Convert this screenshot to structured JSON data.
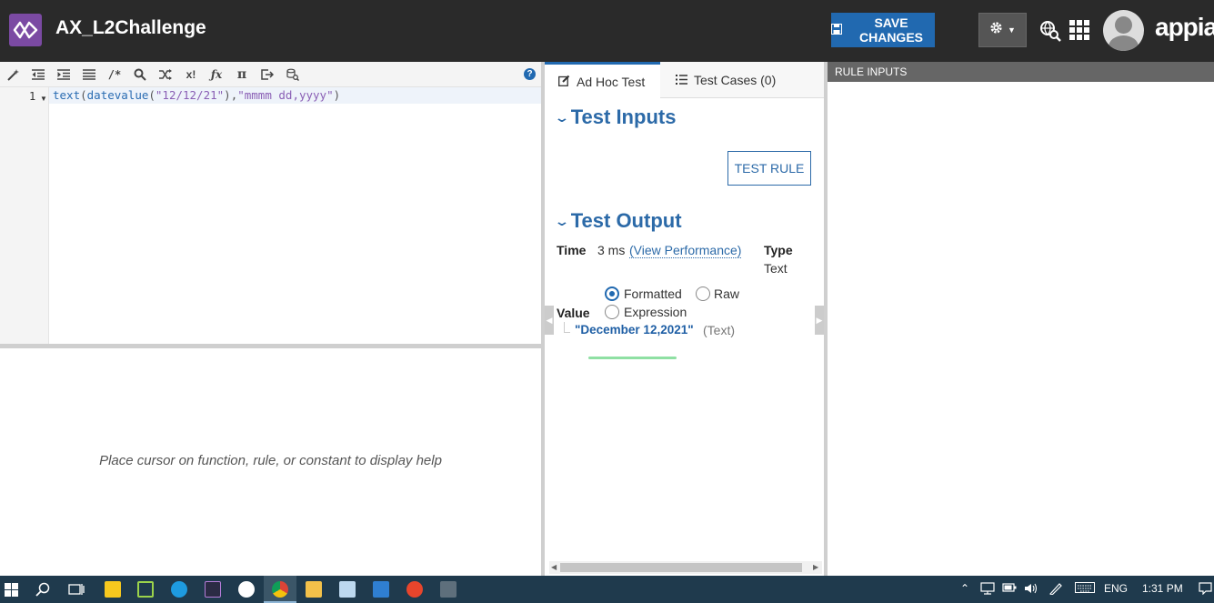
{
  "header": {
    "app_title": "AX_L2Challenge",
    "save_label": "SAVE CHANGES",
    "brand": "appian"
  },
  "editor": {
    "line_number": "1",
    "code": {
      "fn1": "text",
      "p1": "(",
      "fn2": "datevalue",
      "p2": "(",
      "s1": "\"12/12/21\"",
      "p3": "),",
      "s2": "\"mmmm dd,yyyy\"",
      "p4": ")"
    },
    "help_text": "Place cursor on function, rule, or constant to display help"
  },
  "tabs": {
    "adhoc": "Ad Hoc Test",
    "cases": "Test Cases (0)"
  },
  "test_inputs": {
    "title": "Test Inputs",
    "button": "TEST RULE"
  },
  "test_output": {
    "title": "Test Output",
    "time_label": "Time",
    "time_value": "3 ms",
    "perf_link": "(View Performance)",
    "type_label": "Type",
    "type_value": "Text",
    "value_label": "Value",
    "radio_formatted": "Formatted",
    "radio_raw": "Raw",
    "radio_expression": "Expression",
    "selected_format": "Formatted",
    "output_value": "\"December 12,2021\"",
    "output_type": "(Text)"
  },
  "rule_inputs": {
    "title": "RULE INPUTS"
  },
  "taskbar": {
    "lang": "ENG",
    "time": "1:31 PM"
  },
  "colors": {
    "accent": "#2169b0",
    "header_bg": "#2a2a2a",
    "section_title": "#2c6aa8",
    "taskbar_bg": "#1f3a4d",
    "highlight": "#8fe0a3"
  }
}
